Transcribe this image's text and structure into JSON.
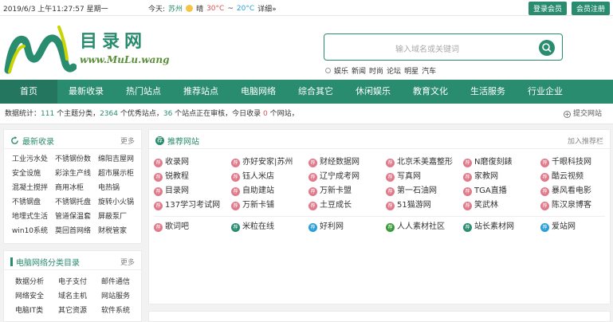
{
  "topbar": {
    "date": "2019/6/3 上午11:27:57 星期一",
    "weather_label": "今天:",
    "city": "苏州",
    "cond": "晴",
    "high": "30°C",
    "sep": "~",
    "low": "20°C",
    "detail": "详细»",
    "login": "登录会员",
    "register": "会员注册"
  },
  "logo": {
    "cn": "目录网",
    "en": "www.MuLu.wang"
  },
  "search": {
    "placeholder": "输入域名或关键词",
    "hot": [
      "娱乐",
      "新闻",
      "时尚",
      "论坛",
      "明星",
      "汽车"
    ]
  },
  "nav": [
    "首页",
    "最新收录",
    "热门站点",
    "推荐站点",
    "电脑网络",
    "综合其它",
    "休闲娱乐",
    "教育文化",
    "生活服务",
    "行业企业"
  ],
  "stats": {
    "p1": "数据统计：",
    "cats": "111",
    "p2": " 个主题分类，",
    "sites": "2364",
    "p3": " 个优秀站点，",
    "pending": "36",
    "p4": " 个站点正在审核，今日收录 ",
    "today": "0",
    "p5": " 个网站，",
    "submit": "提交网站"
  },
  "latest": {
    "title": "最新收录",
    "more": "更多",
    "items": [
      "工业污水处",
      "不锈钢份数",
      "绵阳吉屋网",
      "安全设施",
      "彩涂生产线",
      "超市展示柜",
      "混凝土搅拌",
      "商用冰柜",
      "电热锅",
      "不锈钢盘",
      "不锈钢托盘",
      "旋转小火锅",
      "地埋式生活",
      "管道保温套",
      "屏蔽泵厂",
      "win10系统",
      "莫回首网络",
      "财税管家"
    ]
  },
  "category": {
    "title": "电脑网络分类目录",
    "more": "更多",
    "items": [
      "数据分析",
      "电子支付",
      "邮件通信",
      "网络安全",
      "域名主机",
      "网站服务",
      "电脑IT类",
      "其它资源",
      "软件系统"
    ]
  },
  "recommend": {
    "title": "推荐网站",
    "join": "加入推荐栏",
    "items": [
      "收录网",
      "亦好安家|苏州",
      "财经数据网",
      "北京禾美嘉整形",
      "N磨復刻錶",
      "千眼科技网",
      "锐教程",
      "钰人米店",
      "辽宁成考网",
      "写真网",
      "家教网",
      "酷云视频",
      "目录网",
      "自助建站",
      "万新卡盟",
      "第一石油网",
      "TGA直播",
      "暴风看电影",
      "137学习考试网",
      "万新卡铺",
      "土豆成长",
      "51猫游网",
      "笑武林",
      "陈汉泉博客"
    ],
    "items2": [
      "歌词吧",
      "米粒在线",
      "好利网",
      "人人素材社区",
      "站长素材网",
      "爱站网"
    ],
    "icon_colors2": [
      "#e07a8a",
      "#2a8c6f",
      "#2a9fd6",
      "#3a9a3a",
      "#2a8c6f",
      "#2a9fd6"
    ]
  }
}
